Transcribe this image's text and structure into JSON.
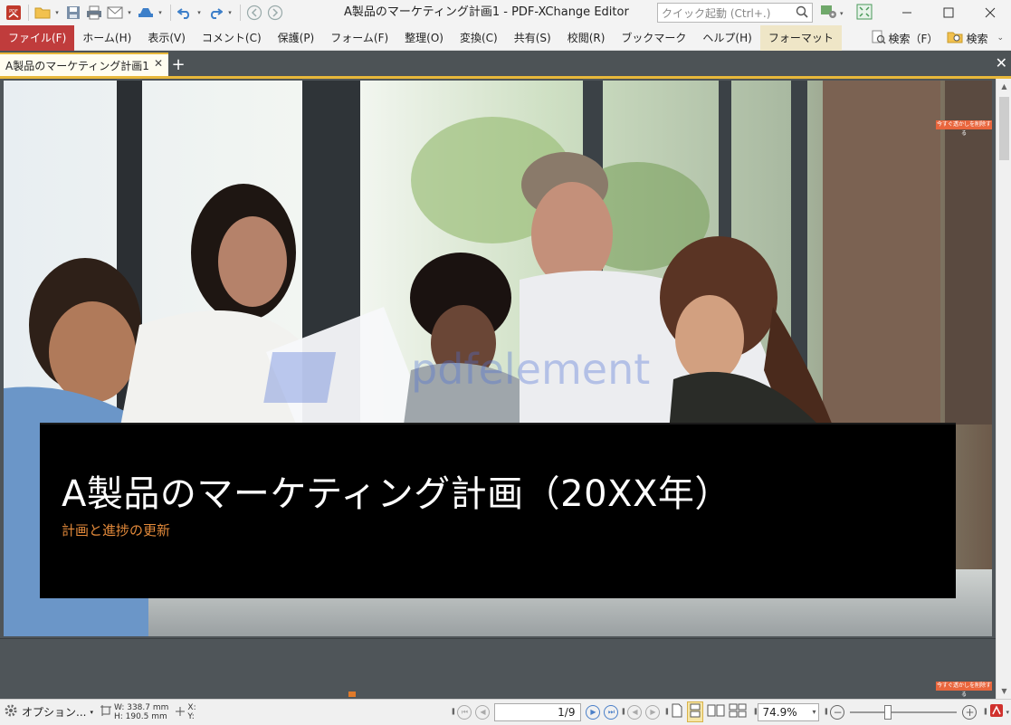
{
  "window": {
    "title": "A製品のマーケティング計画1 - PDF-XChange Editor",
    "quick_launch_placeholder": "クイック起動 (Ctrl+.)"
  },
  "menu": {
    "items": [
      "ファイル(F)",
      "ホーム(H)",
      "表示(V)",
      "コメント(C)",
      "保護(P)",
      "フォーム(F)",
      "整理(O)",
      "変換(C)",
      "共有(S)",
      "校閲(R)",
      "ブックマーク",
      "ヘルプ(H)",
      "フォーマット"
    ],
    "search_find": "検索（F）",
    "search": "検索"
  },
  "tabs": {
    "active_doc": "A製品のマーケティング計画1"
  },
  "document": {
    "title": "A製品のマーケティング計画（20XX年）",
    "subtitle": "計画と進捗の更新",
    "watermark": "pdfelement",
    "tag_text": "今すぐ透かしを削除する"
  },
  "status": {
    "options_label": "オプション...",
    "width": "W: 338.7 mm",
    "height": "H: 190.5 mm",
    "cursor_x": "X:",
    "cursor_y": "Y:",
    "page_indicator": "1/9",
    "zoom": "74.9%"
  },
  "colors": {
    "file_menu": "#c03c3c",
    "tab_accent": "#e8b83a",
    "subtitle": "#e2893a",
    "tag": "#e9663d"
  }
}
